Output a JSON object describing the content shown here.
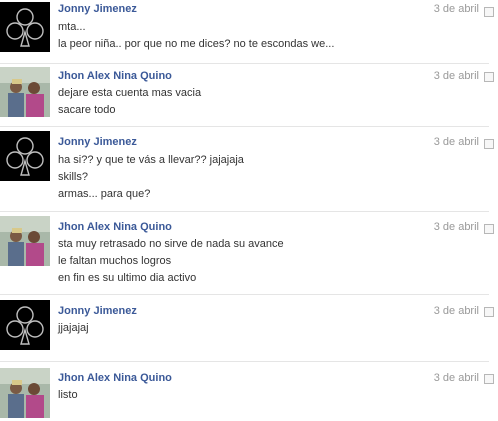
{
  "messages": [
    {
      "sender": "Jonny Jimenez",
      "avatar": "black-club-icon",
      "date": "3 de abril",
      "lines": [
        "mta...",
        "la peor niña.. por que no me dices? no te escondas we..."
      ]
    },
    {
      "sender": "Jhon Alex Nina Quino",
      "avatar": "couple-photo",
      "date": "3 de abril",
      "lines": [
        "dejare esta cuenta mas vacia",
        "sacare todo"
      ]
    },
    {
      "sender": "Jonny Jimenez",
      "avatar": "black-club-icon",
      "date": "3 de abril",
      "lines": [
        "ha si?? y que te vás a llevar?? jajajaja",
        "skills?",
        "armas... para que?"
      ]
    },
    {
      "sender": "Jhon Alex Nina Quino",
      "avatar": "couple-photo",
      "date": "3 de abril",
      "lines": [
        "sta muy retrasado no sirve de nada su avance",
        "le faltan muchos logros",
        "en fin es su ultimo dia activo"
      ]
    },
    {
      "sender": "Jonny Jimenez",
      "avatar": "black-club-icon",
      "date": "3 de abril",
      "lines": [
        "jjajajaj"
      ]
    },
    {
      "sender": "Jhon Alex Nina Quino",
      "avatar": "couple-photo",
      "date": "3 de abril",
      "lines": [
        "listo"
      ]
    }
  ],
  "colors": {
    "sender_link": "#3b5998",
    "date_text": "#999999",
    "body_text": "#333333",
    "divider": "#e5e5e5"
  }
}
